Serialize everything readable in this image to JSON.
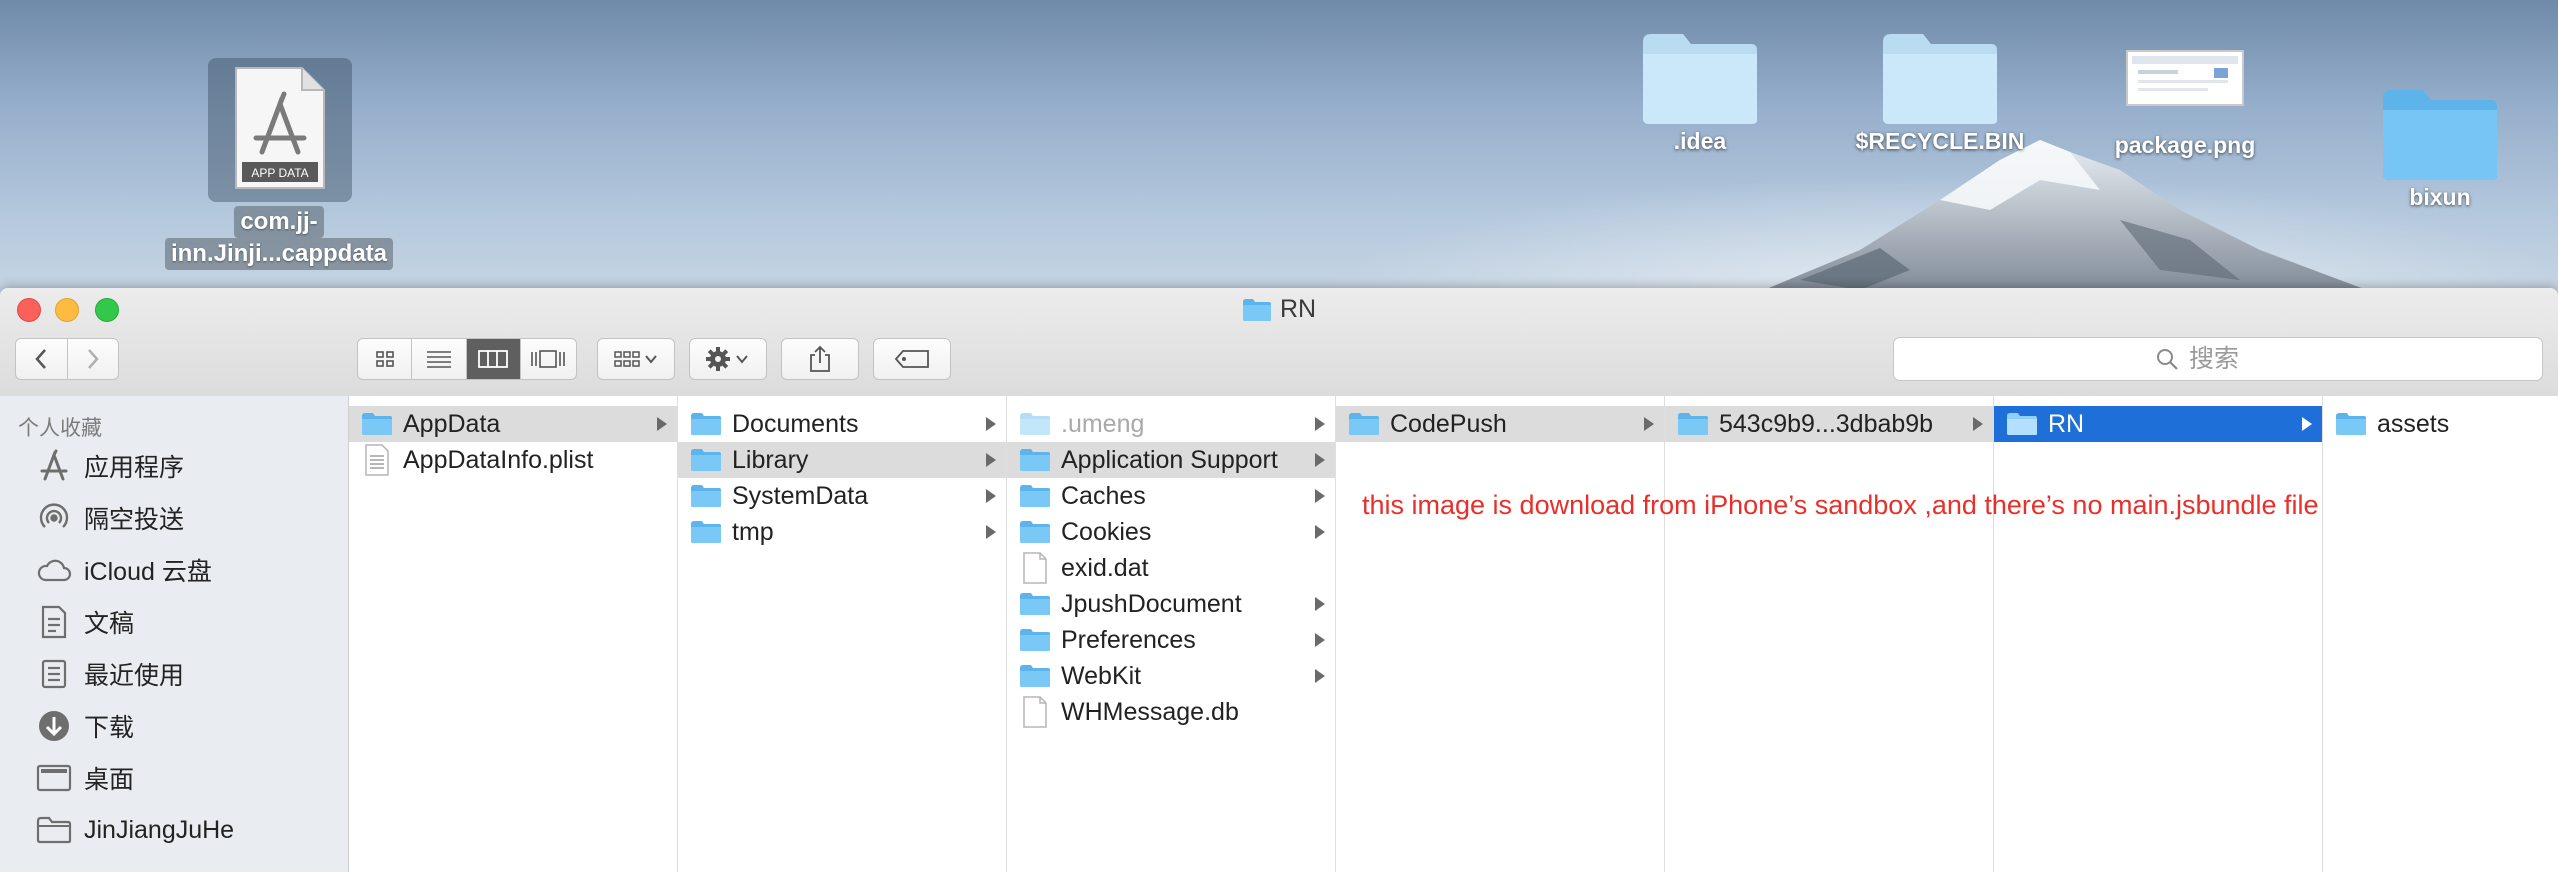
{
  "desktop": {
    "selected_file_label_line1": "com.jj-",
    "selected_file_label_line2": "inn.Jinji...cappdata",
    "appdata_badge": "APP DATA",
    "icons": [
      {
        "label": ".idea",
        "icon": "folder-icon"
      },
      {
        "label": "$RECYCLE.BIN",
        "icon": "folder-icon"
      },
      {
        "label": "package.png",
        "icon": "image-thumbnail"
      },
      {
        "label": "bixun",
        "icon": "folder-icon"
      }
    ]
  },
  "window": {
    "title": "RN",
    "search_placeholder": "搜索",
    "accent_color": "#1f6fd8"
  },
  "sidebar": {
    "section": "个人收藏",
    "items": [
      {
        "label": "应用程序",
        "icon": "applications-icon"
      },
      {
        "label": "隔空投送",
        "icon": "airdrop-icon"
      },
      {
        "label": "iCloud 云盘",
        "icon": "cloud-icon"
      },
      {
        "label": "文稿",
        "icon": "documents-icon"
      },
      {
        "label": "最近使用",
        "icon": "recents-icon"
      },
      {
        "label": "下载",
        "icon": "downloads-icon"
      },
      {
        "label": "桌面",
        "icon": "desktop-icon"
      },
      {
        "label": "JinJiangJuHe",
        "icon": "folder-icon"
      }
    ]
  },
  "columns": [
    [
      {
        "label": "AppData"
      },
      {
        "label": "AppDataInfo.plist"
      }
    ],
    [
      {
        "label": "Documents"
      },
      {
        "label": "Library"
      },
      {
        "label": "SystemData"
      },
      {
        "label": "tmp"
      }
    ],
    [
      {
        "label": ".umeng"
      },
      {
        "label": "Application Support"
      },
      {
        "label": "Caches"
      },
      {
        "label": "Cookies"
      },
      {
        "label": "exid.dat"
      },
      {
        "label": "JpushDocument"
      },
      {
        "label": "Preferences"
      },
      {
        "label": "WebKit"
      },
      {
        "label": "WHMessage.db"
      }
    ],
    [
      {
        "label": "CodePush"
      }
    ],
    [
      {
        "label": "543c9b9...3dbab9b"
      }
    ],
    [
      {
        "label": "RN"
      }
    ],
    [
      {
        "label": "assets"
      }
    ]
  ],
  "annotation": "this image is download from iPhone’s sandbox ,and there’s no main.jsbundle file"
}
